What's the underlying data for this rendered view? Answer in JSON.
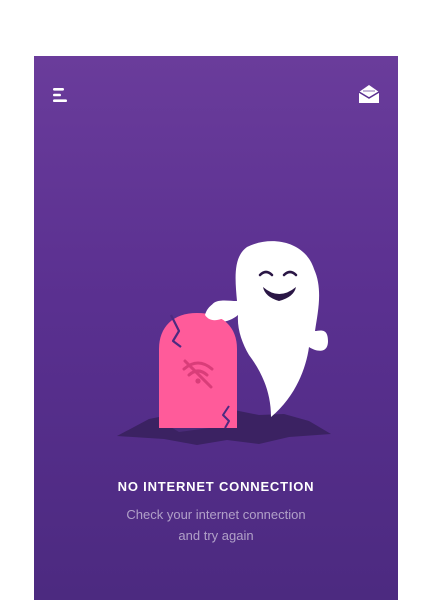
{
  "screen": {
    "background_top": "#6a3c9b",
    "background_bottom": "#4c2a80",
    "accent": "#ff5b9a"
  },
  "top_bar": {
    "menu_icon": "hamburger-menu-icon",
    "mail_icon": "envelope-open-icon"
  },
  "illustration": {
    "icon": "ghost-tombstone-no-wifi-illustration"
  },
  "message": {
    "title": "NO INTERNET CONNECTION",
    "subtitle_line1": "Check your internet connection",
    "subtitle_line2": "and try again"
  }
}
